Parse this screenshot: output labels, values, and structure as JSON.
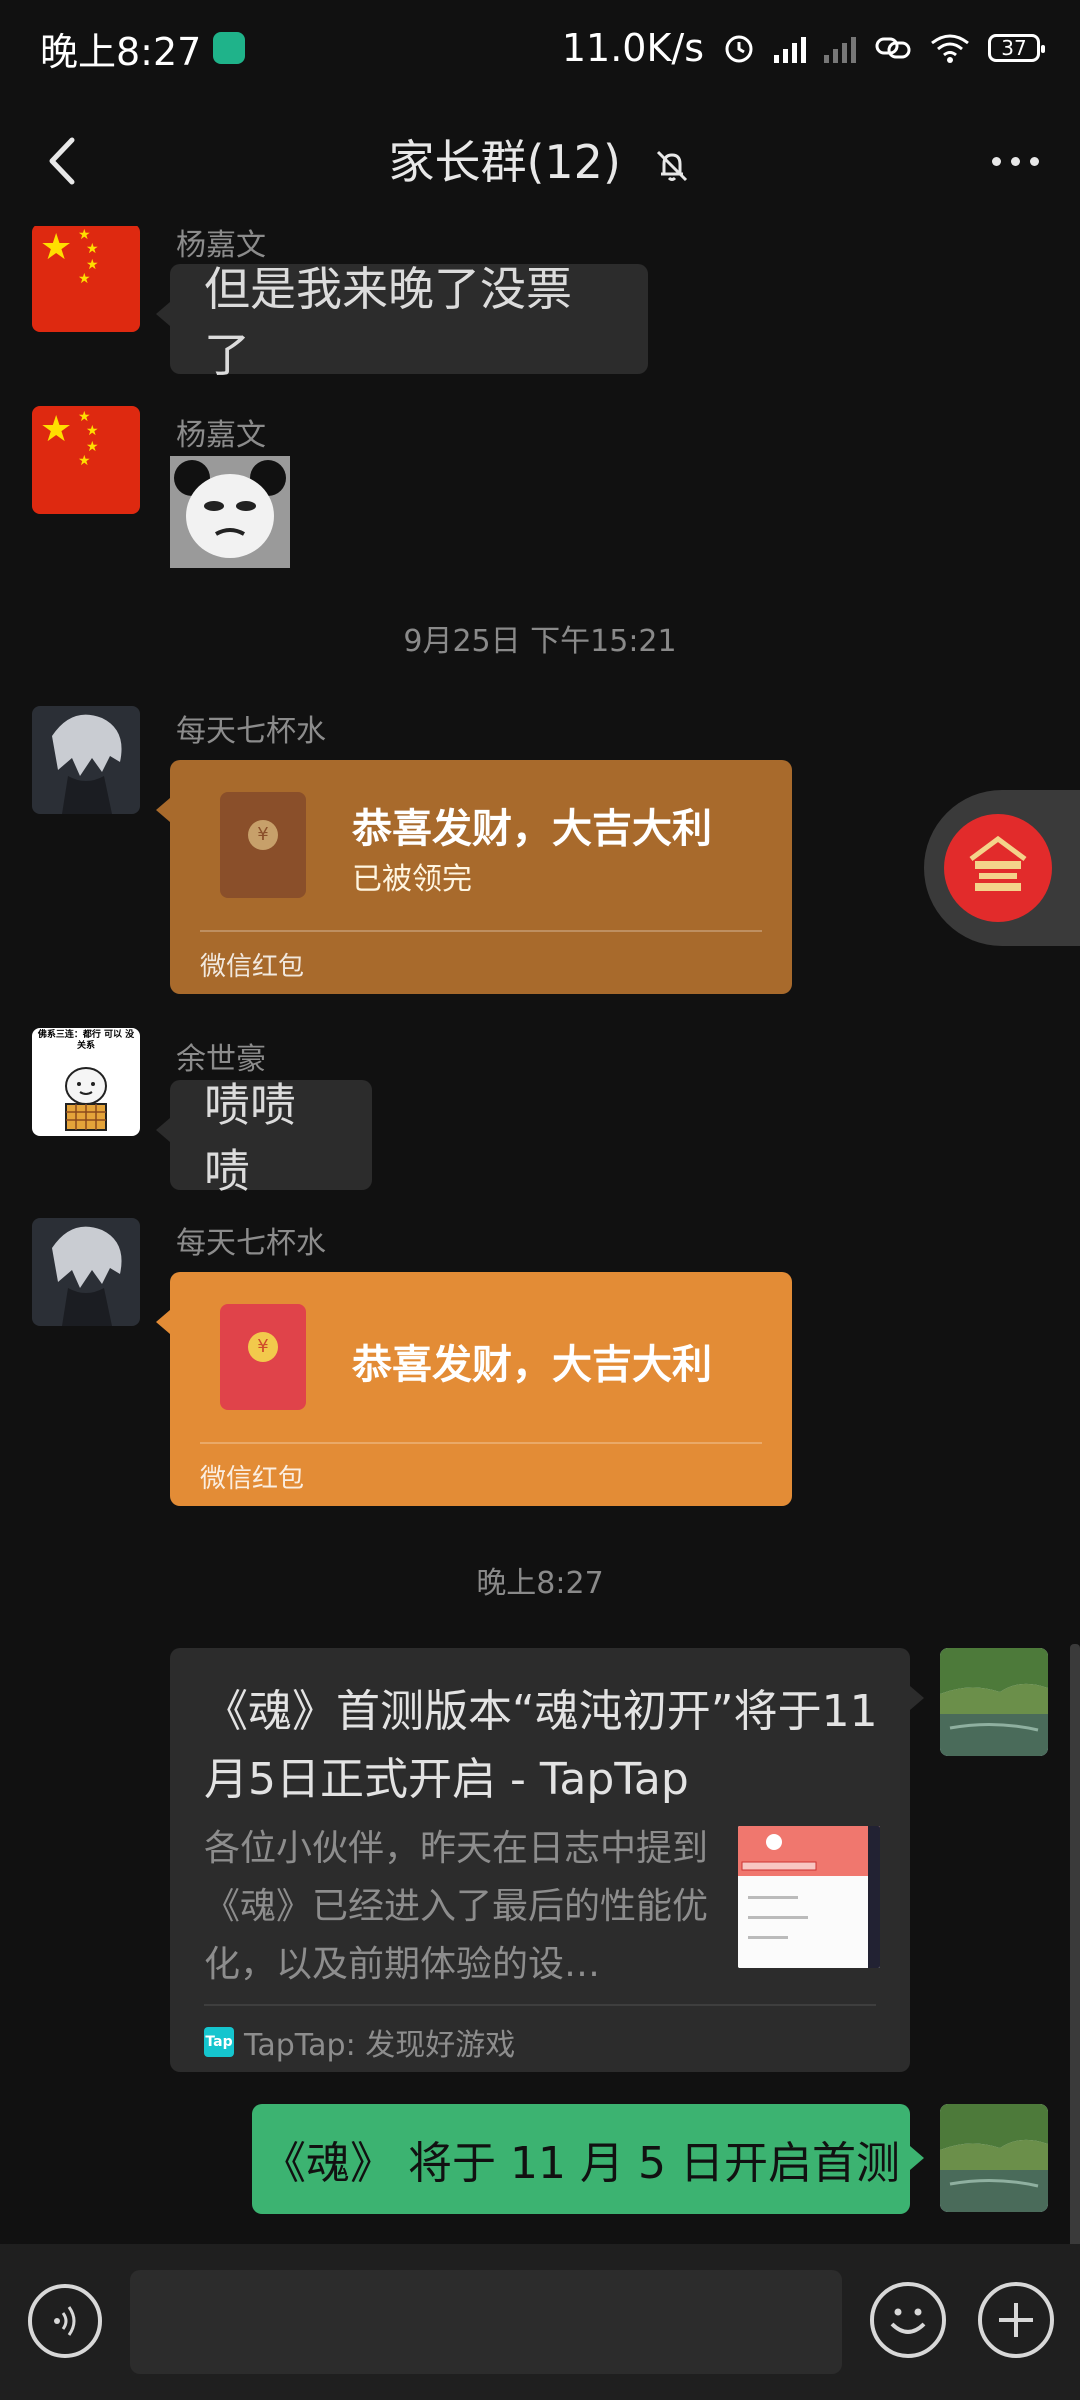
{
  "status_bar": {
    "time": "晚上8:27",
    "network_speed": "11.0K/s",
    "battery": "37"
  },
  "header": {
    "title": "家长群(12)"
  },
  "messages": [
    {
      "sender": "杨嘉文",
      "text": "但是我来晚了没票了"
    },
    {
      "sender": "杨嘉文"
    },
    {
      "timestamp": "9月25日 下午15:21"
    },
    {
      "sender": "每天七杯水",
      "red_packet": {
        "title": "恭喜发财，大吉大利",
        "status": "已被领完",
        "footer": "微信红包"
      }
    },
    {
      "sender": "余世豪",
      "text": "啧啧啧",
      "avatar_caption": "佛系三连：都行 可以 没关系"
    },
    {
      "sender": "每天七杯水",
      "red_packet": {
        "title": "恭喜发财，大吉大利",
        "footer": "微信红包"
      }
    },
    {
      "timestamp": "晚上8:27"
    },
    {
      "link_card": {
        "title": "《魂》首测版本“魂沌初开”将于11月5日正式开启 - TapTap",
        "description": "各位小伙伴，昨天在日志中提到《魂》已经进入了最后的性能优化，以及前期体验的设…",
        "source": "TapTap: 发现好游戏",
        "source_logo": "Tap"
      }
    },
    {
      "text": "《魂》 将于 11 月 5 日开启首测"
    }
  ],
  "input": {
    "value": ""
  },
  "colors": {
    "background": "#111111",
    "bubble_received": "#2c2c2c",
    "bubble_sent": "#3cb371",
    "red_packet_opened": "#a86a2c",
    "red_packet_unopened": "#e38c36"
  }
}
